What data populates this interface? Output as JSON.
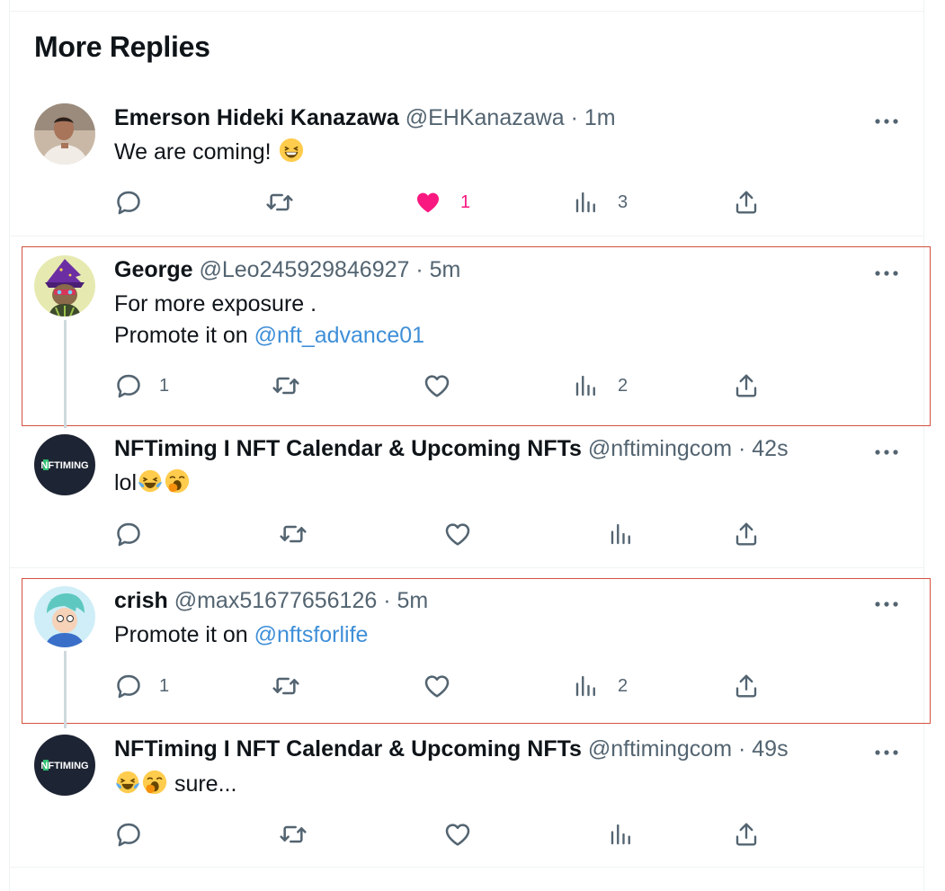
{
  "header": {
    "title": "More Replies"
  },
  "posts": [
    {
      "name": "Emerson Hideki Kanazawa",
      "handle": "@EHKanazawa",
      "time": "1m",
      "text_plain": "We are coming!",
      "emoji_names": [
        "grinning-squinting-emoji"
      ],
      "counts": {
        "replies": "",
        "retweets": "",
        "likes": "1",
        "views": "3"
      },
      "liked": true,
      "avatar": "photo-avatar"
    },
    {
      "name": "George",
      "handle": "@Leo245929846927",
      "time": "5m",
      "line1": "For more exposure .",
      "line2_plain": "Promote it on ",
      "mention": "@nft_advance01",
      "counts": {
        "replies": "1",
        "retweets": "",
        "likes": "",
        "views": "2"
      },
      "liked": false,
      "avatar": "wizard-ape-avatar"
    },
    {
      "name": "NFTiming I NFT Calendar & Upcoming NFTs",
      "handle": "@nftimingcom",
      "time": "42s",
      "text_plain": "lol",
      "emoji_names": [
        "tears-of-joy-emoji",
        "yawning-face-emoji"
      ],
      "counts": {
        "replies": "",
        "retweets": "",
        "likes": "",
        "views": ""
      },
      "liked": false,
      "avatar": "nftiming-logo-avatar",
      "avatar_text": "NFTIMING"
    },
    {
      "name": "crish",
      "handle": "@max51677656126",
      "time": "5m",
      "line2_plain": "Promote it on ",
      "mention": "@nftsforlife",
      "counts": {
        "replies": "1",
        "retweets": "",
        "likes": "",
        "views": "2"
      },
      "liked": false,
      "avatar": "cartoon-boy-avatar"
    },
    {
      "name": "NFTiming I NFT Calendar & Upcoming NFTs",
      "handle": "@nftimingcom",
      "time": "49s",
      "text_after": " sure...",
      "emoji_names": [
        "tears-of-joy-emoji",
        "yawning-face-emoji"
      ],
      "counts": {
        "replies": "",
        "retweets": "",
        "likes": "",
        "views": ""
      },
      "liked": false,
      "avatar": "nftiming-logo-avatar",
      "avatar_text": "NFTIMING"
    }
  ],
  "separators": {
    "dot": "·"
  },
  "colors": {
    "accent": "#1d9bf0",
    "like": "#f91880",
    "muted": "#536471",
    "highlight_box": "#d2533e"
  }
}
